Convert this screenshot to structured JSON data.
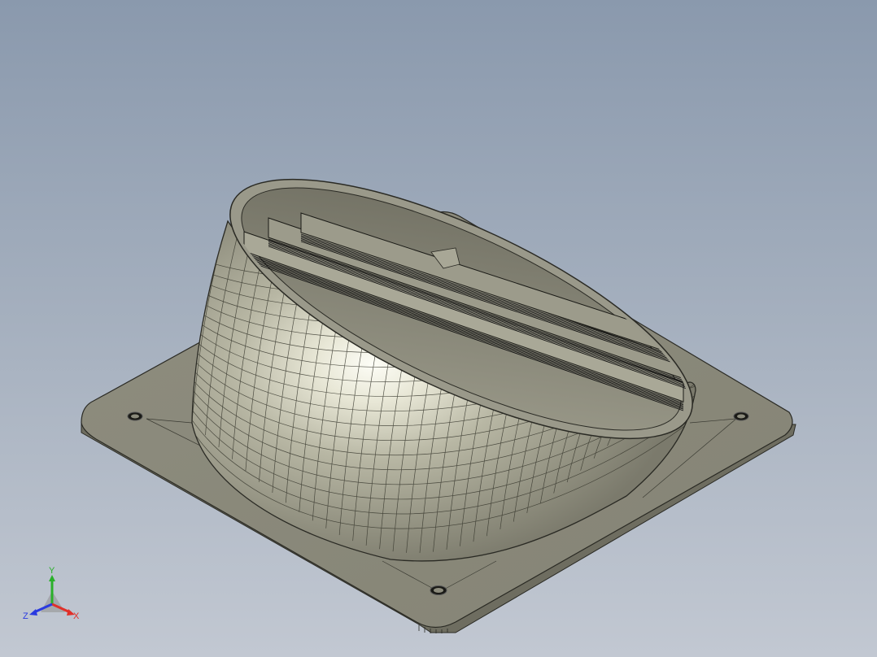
{
  "viewport": {
    "background_top": "#8a99ad",
    "background_bottom": "#c2c8d2"
  },
  "model": {
    "part": "duct-adapter",
    "base_plate_color": "#8c8b7c",
    "surface_color": "#b8b7a4",
    "highlight_color": "#fdfdf6",
    "edge_color": "#2a2a24",
    "mounting_holes": 4,
    "louver_slats": 3
  },
  "triad": {
    "x_label": "X",
    "y_label": "Y",
    "z_label": "Z",
    "x_color": "#e0302a",
    "y_color": "#2ab02a",
    "z_color": "#2a3ae0"
  }
}
